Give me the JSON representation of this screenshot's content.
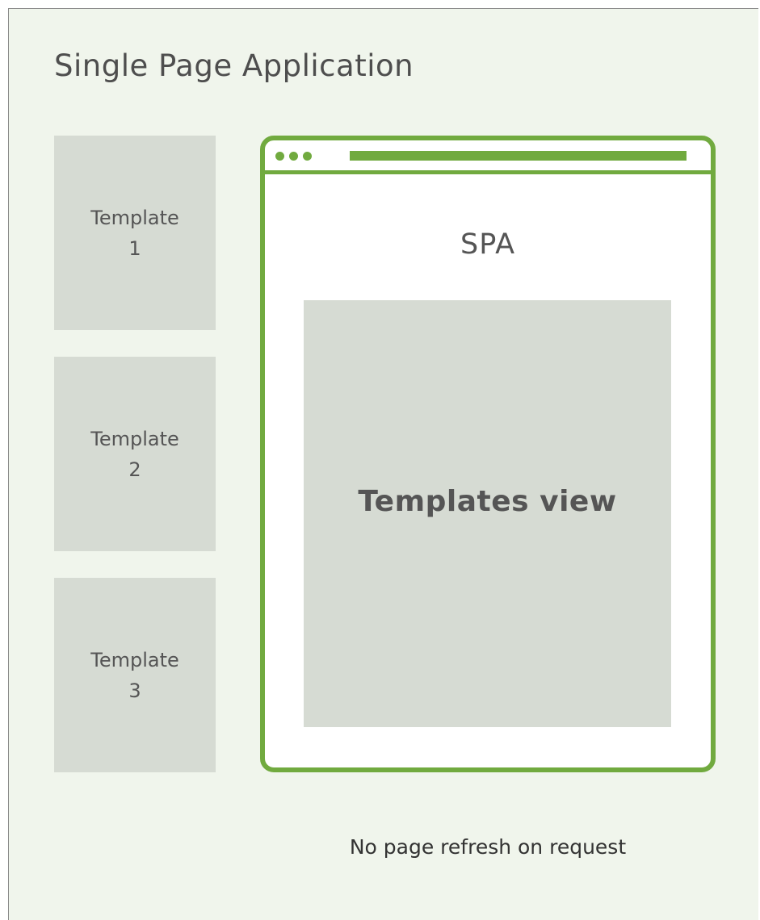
{
  "title": "Single Page Application",
  "templates": [
    {
      "line1": "Template",
      "line2": "1"
    },
    {
      "line1": "Template",
      "line2": "2"
    },
    {
      "line1": "Template",
      "line2": "3"
    }
  ],
  "browser": {
    "label": "SPA",
    "view_label": "Templates view",
    "accent_color": "#71aa3f"
  },
  "footer_note": "No page refresh on request",
  "colors": {
    "background": "#f0f5ec",
    "panel": "#d6dbd3",
    "text": "#555555",
    "accent": "#71aa3f"
  }
}
